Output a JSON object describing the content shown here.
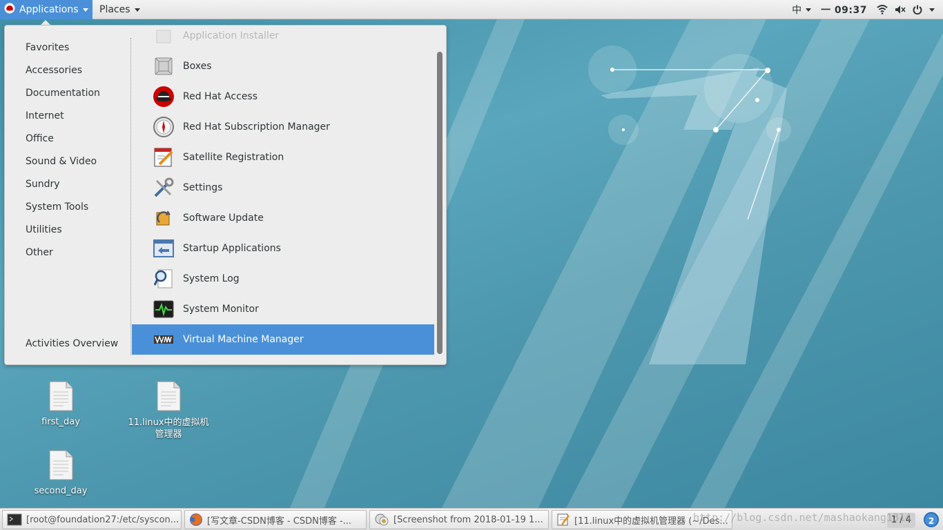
{
  "topbar": {
    "applications_label": "Applications",
    "places_label": "Places",
    "input_method": "中",
    "clock": "一 09:37"
  },
  "menu": {
    "categories": [
      "Favorites",
      "Accessories",
      "Documentation",
      "Internet",
      "Office",
      "Sound & Video",
      "Sundry",
      "System Tools",
      "Utilities",
      "Other"
    ],
    "activities_overview": "Activities Overview",
    "apps": [
      {
        "label": "Application Installer",
        "icon": "package-icon"
      },
      {
        "label": "Boxes",
        "icon": "boxes-icon"
      },
      {
        "label": "Red Hat Access",
        "icon": "redhat-icon"
      },
      {
        "label": "Red Hat Subscription Manager",
        "icon": "compass-icon"
      },
      {
        "label": "Satellite Registration",
        "icon": "pencil-note-icon"
      },
      {
        "label": "Settings",
        "icon": "tools-icon"
      },
      {
        "label": "Software Update",
        "icon": "update-icon"
      },
      {
        "label": "Startup Applications",
        "icon": "startup-icon"
      },
      {
        "label": "System Log",
        "icon": "log-icon"
      },
      {
        "label": "System Monitor",
        "icon": "monitor-icon"
      },
      {
        "label": "Virtual Machine Manager",
        "icon": "vm-icon"
      }
    ]
  },
  "desktop": {
    "icons": [
      {
        "label": "first_day"
      },
      {
        "label": "11.linux中的虚拟机管理器"
      },
      {
        "label": "second_day"
      }
    ]
  },
  "taskbar": {
    "tasks": [
      {
        "label": "[root@foundation27:/etc/syscon..."
      },
      {
        "label": "[写文章-CSDN博客 - CSDN博客 -..."
      },
      {
        "label": "[Screenshot from 2018-01-19 1..."
      },
      {
        "label": "[11.linux中的虚拟机管理器 (~/Des..."
      }
    ],
    "workspace": "1 / 4",
    "notification_count": "2",
    "watermark": "http://blog.csdn.net/mashaokang1314"
  },
  "colors": {
    "accent": "#4a90d9"
  }
}
